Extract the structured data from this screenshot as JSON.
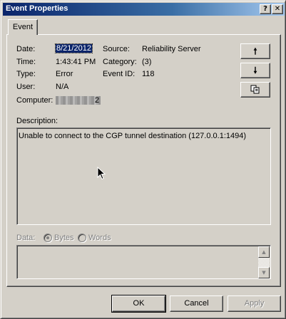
{
  "window": {
    "title": "Event Properties",
    "help_button": "?",
    "close_button": "X"
  },
  "tabs": [
    {
      "label": "Event"
    }
  ],
  "event": {
    "date_label": "Date:",
    "date_value": "8/21/2012",
    "time_label": "Time:",
    "time_value": "1:43:41 PM",
    "type_label": "Type:",
    "type_value": "Error",
    "user_label": "User:",
    "user_value": "N/A",
    "computer_label": "Computer:",
    "computer_value_visible_tail": "2",
    "source_label": "Source:",
    "source_value": "Reliability Server",
    "category_label": "Category:",
    "category_value": "(3)",
    "event_id_label": "Event ID:",
    "event_id_value": "118"
  },
  "side_buttons": {
    "up_icon": "arrow-up-icon",
    "down_icon": "arrow-down-icon",
    "copy_icon": "copy-icon"
  },
  "description": {
    "label": "Description:",
    "text": "Unable to connect to the CGP tunnel destination (127.0.0.1:1494)"
  },
  "data_section": {
    "label": "Data:",
    "bytes_label": "Bytes",
    "words_label": "Words",
    "selected": "Bytes"
  },
  "footer": {
    "ok_label": "OK",
    "cancel_label": "Cancel",
    "apply_label": "Apply"
  }
}
